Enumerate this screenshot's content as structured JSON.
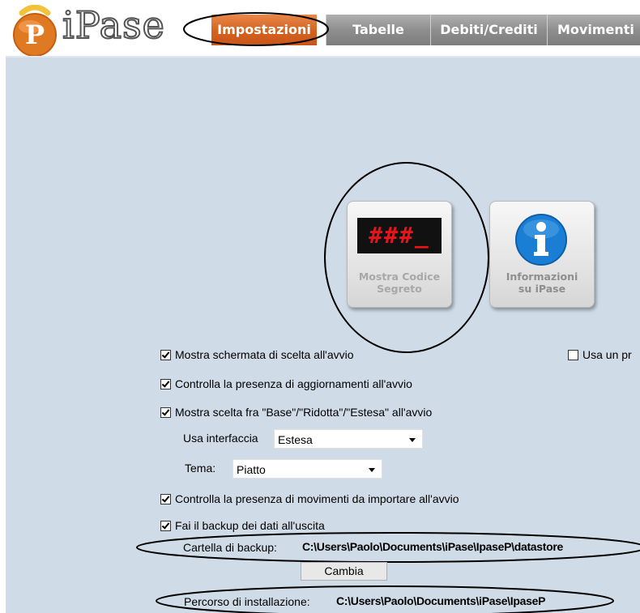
{
  "brand": {
    "name": "iPase",
    "logo_letter": "P"
  },
  "tabs": [
    {
      "label": "Impostazioni",
      "active": true
    },
    {
      "label": "Tabelle",
      "active": false
    },
    {
      "label": "Debiti/Crediti",
      "active": false
    },
    {
      "label": "Movimenti",
      "active": false
    }
  ],
  "buttons": {
    "secret_code": {
      "display": "###_",
      "label_line1": "Mostra Codice",
      "label_line2": "Segreto",
      "icon": "code-display-icon"
    },
    "info": {
      "label_line1": "Informazioni",
      "label_line2": "su iPase",
      "icon": "info-icon"
    }
  },
  "options": {
    "show_choice_screen": {
      "label": "Mostra schermata di scelta all'avvio",
      "checked": true
    },
    "use_other": {
      "label": "Usa un pr",
      "checked": false
    },
    "check_updates": {
      "label": "Controlla la presenza di aggiornamenti all'avvio",
      "checked": true
    },
    "show_mode_choice": {
      "label": "Mostra scelta fra \"Base\"/\"Ridotta\"/\"Estesa\" all'avvio",
      "checked": true
    },
    "interface": {
      "label": "Usa interfaccia",
      "value": "Estesa"
    },
    "theme": {
      "label": "Tema:",
      "value": "Piatto"
    },
    "check_imports": {
      "label": "Controlla la presenza di movimenti da importare all'avvio",
      "checked": true
    },
    "backup_on_exit": {
      "label": "Fai il backup dei dati all'uscita",
      "checked": true
    }
  },
  "backup": {
    "label": "Cartella di backup:",
    "path": "C:\\Users\\Paolo\\Documents\\iPase\\IpaseP\\datastore",
    "change_label": "Cambia"
  },
  "install": {
    "label": "Percorso di installazione:",
    "path": "C:\\Users\\Paolo\\Documents\\iPase\\IpaseP"
  },
  "colors": {
    "active_tab": "#d4621e",
    "panel_bg": "#cfdbe7",
    "info_blue": "#1a7fd4",
    "led_red": "#e8141a"
  }
}
